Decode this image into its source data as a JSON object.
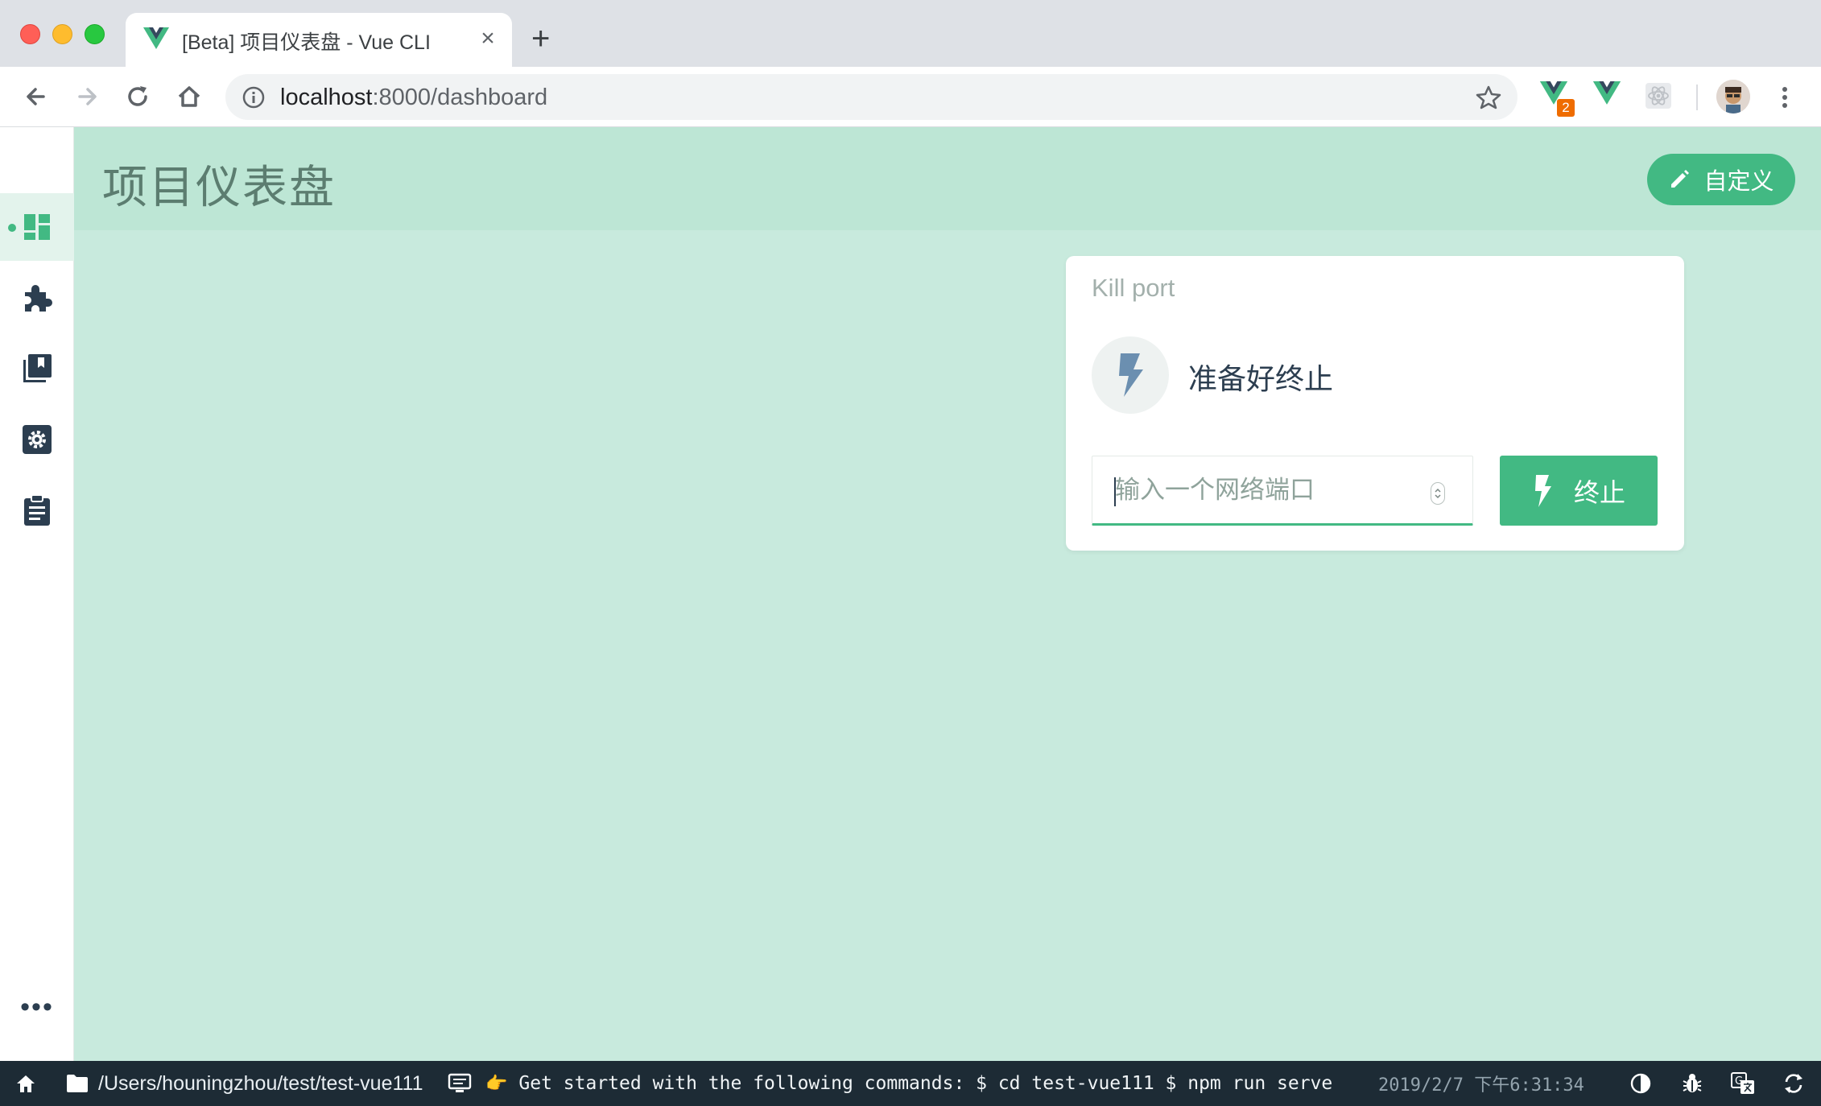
{
  "browser": {
    "tab_title": "[Beta] 项目仪表盘 - Vue CLI",
    "tab_close": "×",
    "new_tab": "+",
    "url_host": "localhost",
    "url_rest": ":8000/dashboard",
    "extension_badge": "2"
  },
  "sidebar": {
    "items": [
      {
        "name": "dashboard",
        "icon": "dashboard-icon",
        "active": true
      },
      {
        "name": "plugins",
        "icon": "puzzle-icon",
        "active": false
      },
      {
        "name": "dependencies",
        "icon": "library-books-icon",
        "active": false
      },
      {
        "name": "configuration",
        "icon": "settings-box-icon",
        "active": false
      },
      {
        "name": "tasks",
        "icon": "clipboard-icon",
        "active": false
      }
    ],
    "more_label": "•••"
  },
  "header": {
    "title": "项目仪表盘",
    "customize_label": "自定义"
  },
  "widget": {
    "title": "Kill port",
    "status": "准备好终止",
    "port_placeholder": "输入一个网络端口",
    "kill_label": "终止"
  },
  "statusbar": {
    "path": "/Users/houningzhou/test/test-vue111",
    "log_emoji": "👉",
    "log": "Get started with the following commands: $ cd test-vue111 $ npm run serve",
    "time": "2019/2/7 下午6:31:34"
  },
  "colors": {
    "accent": "#42b983",
    "main_bg": "#c8eadd",
    "header_bg": "#bde6d5",
    "dark": "#2c3e50",
    "statusbar_bg": "#1d2b35"
  }
}
